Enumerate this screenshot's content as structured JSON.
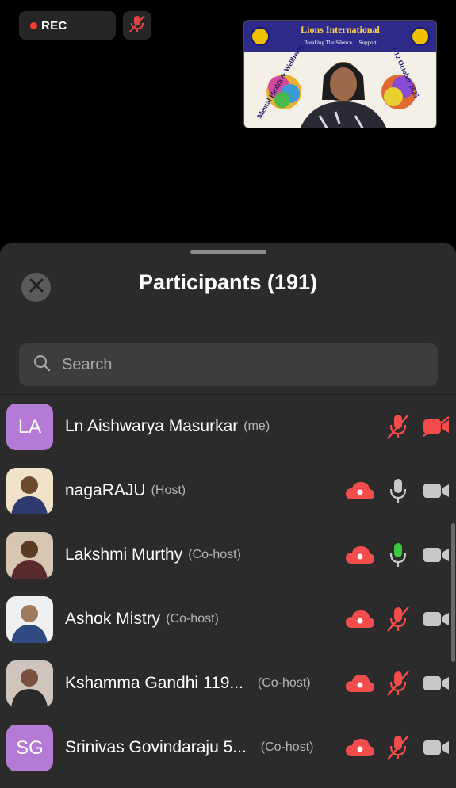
{
  "top_bar": {
    "rec_label": "REC",
    "mic_icon": "muted-mic-icon"
  },
  "video_tile": {
    "banner_title": "Lions International",
    "banner_subtitle": "Breaking The Silence ... Support",
    "side_left": "Mental Health & Wellbeing",
    "side_right": "4-12 October 2025"
  },
  "panel": {
    "title": "Participants (191)",
    "close_icon": "close-icon",
    "search_placeholder": "Search"
  },
  "colors": {
    "accent_red": "#f24c4c",
    "active_green": "#3ac93a",
    "avatar_purple": "#b57ad6",
    "sheet_bg": "#2b2b2b"
  },
  "participants": [
    {
      "initials": "LA",
      "name": "Ln Aishwarya Masurkar",
      "role": "(me)",
      "cloud": false,
      "mic": "muted",
      "video": "off"
    },
    {
      "initials": "",
      "name": "nagaRAJU",
      "role": "(Host)",
      "cloud": true,
      "mic": "on",
      "video": "on"
    },
    {
      "initials": "",
      "name": "Lakshmi Murthy",
      "role": "(Co-host)",
      "cloud": true,
      "mic": "speaking",
      "video": "on"
    },
    {
      "initials": "",
      "name": "Ashok Mistry",
      "role": "(Co-host)",
      "cloud": true,
      "mic": "muted",
      "video": "on"
    },
    {
      "initials": "",
      "name": "Kshamma Gandhi 119...",
      "role": "(Co-host)",
      "cloud": true,
      "mic": "muted",
      "video": "on"
    },
    {
      "initials": "SG",
      "name": "Srinivas Govindaraju 5...",
      "role": "(Co-host)",
      "cloud": true,
      "mic": "muted",
      "video": "on"
    }
  ]
}
